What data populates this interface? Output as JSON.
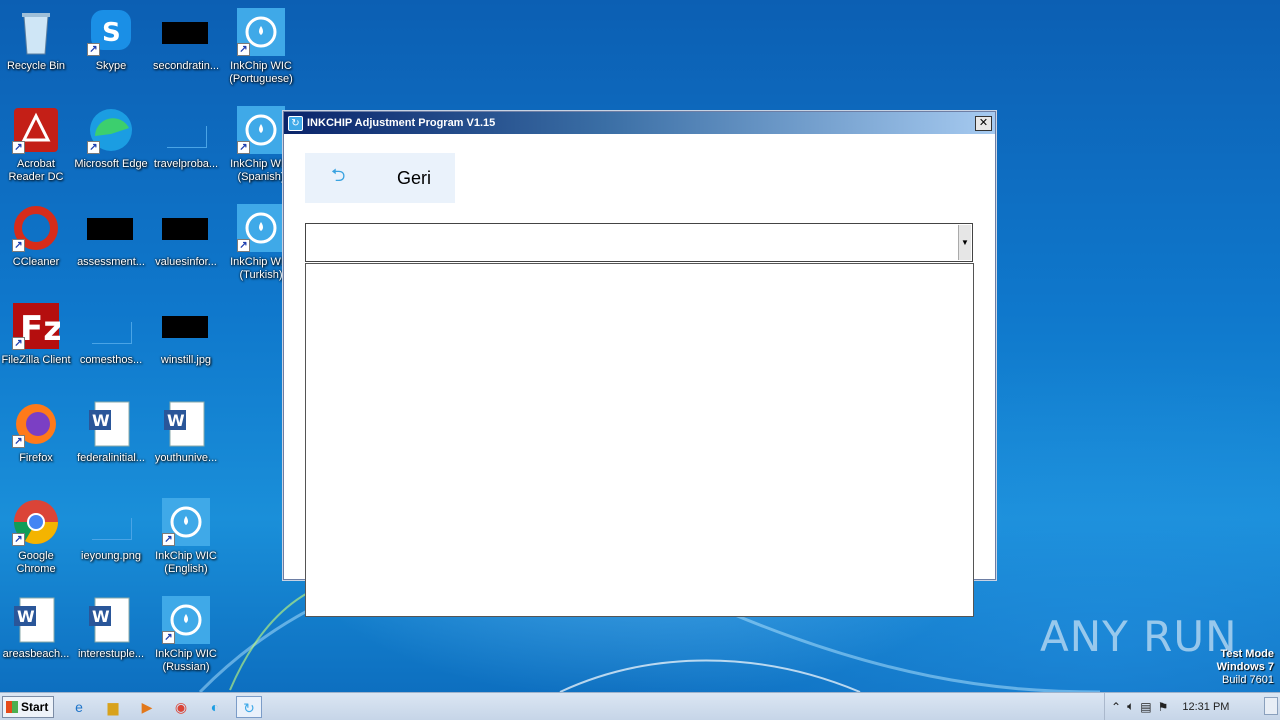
{
  "desktop": {
    "icons": [
      {
        "label": "Recycle Bin",
        "icon": "recycle-bin-icon"
      },
      {
        "label": "Skype",
        "icon": "skype-icon"
      },
      {
        "label": "secondratin...",
        "icon": "image-file-icon"
      },
      {
        "label": "InkChip WIC\n(Portuguese)",
        "icon": "inkchip-icon"
      },
      {
        "label": "Acrobat\nReader DC",
        "icon": "acrobat-icon"
      },
      {
        "label": "Microsoft Edge",
        "icon": "edge-icon"
      },
      {
        "label": "travelproba...",
        "icon": "file-icon"
      },
      {
        "label": "InkChip WIC\n(Spanish)",
        "icon": "inkchip-icon"
      },
      {
        "label": "CCleaner",
        "icon": "ccleaner-icon"
      },
      {
        "label": "assessment...",
        "icon": "image-file-icon"
      },
      {
        "label": "valuesinfor...",
        "icon": "image-file-icon"
      },
      {
        "label": "InkChip WIC\n(Turkish)",
        "icon": "inkchip-icon"
      },
      {
        "label": "FileZilla Client",
        "icon": "filezilla-icon"
      },
      {
        "label": "comesthos...",
        "icon": "file-icon"
      },
      {
        "label": "winstill.jpg",
        "icon": "image-file-icon"
      },
      {
        "label": "Firefox",
        "icon": "firefox-icon"
      },
      {
        "label": "federalinitial...",
        "icon": "word-doc-icon"
      },
      {
        "label": "youthunive...",
        "icon": "word-doc-icon"
      },
      {
        "label": "Google\nChrome",
        "icon": "chrome-icon"
      },
      {
        "label": "ieyoung.png",
        "icon": "file-icon"
      },
      {
        "label": "InkChip WIC\n(English)",
        "icon": "inkchip-icon"
      },
      {
        "label": "areasbeach...",
        "icon": "word-doc-icon"
      },
      {
        "label": "interestuple...",
        "icon": "word-doc-icon"
      },
      {
        "label": "InkChip WIC\n(Russian)",
        "icon": "inkchip-icon"
      }
    ]
  },
  "window": {
    "title": "INKCHIP Adjustment Program V1.15",
    "close_label": "✕",
    "back_button": {
      "label": "Geri",
      "icon": "back-arrow-icon"
    },
    "combo_value": "",
    "list_items": []
  },
  "watermark": {
    "text": "ANY RUN"
  },
  "test_mode": {
    "line1": "Test Mode",
    "line2": "Windows 7",
    "line3": "Build 7601"
  },
  "taskbar": {
    "start_label": "Start",
    "clock": "12:31 PM",
    "pinned": [
      {
        "icon": "internet-explorer-icon"
      },
      {
        "icon": "file-explorer-icon"
      },
      {
        "icon": "media-player-icon"
      },
      {
        "icon": "chrome-icon"
      },
      {
        "icon": "edge-icon"
      },
      {
        "icon": "inkchip-icon",
        "active": true
      }
    ]
  }
}
